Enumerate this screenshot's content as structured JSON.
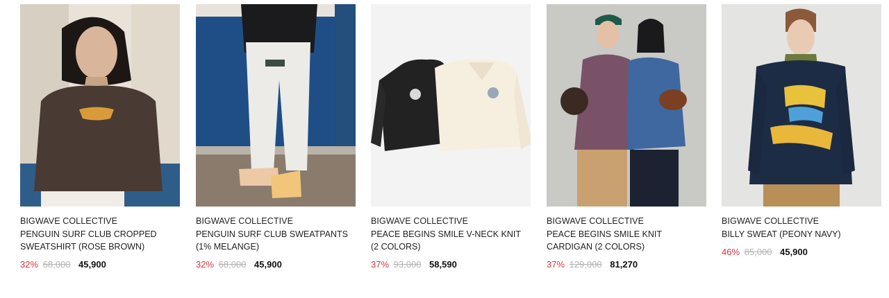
{
  "products": [
    {
      "brand": "BIGWAVE COLLECTIVE",
      "name": "PENGUIN SURF CLUB CROPPED SWEATSHIRT (ROSE BROWN)",
      "discount": "32%",
      "original_price": "68,000",
      "sale_price": "45,900"
    },
    {
      "brand": "BIGWAVE COLLECTIVE",
      "name": "PENGUIN SURF CLUB SWEATPANTS (1% MELANGE)",
      "discount": "32%",
      "original_price": "68,000",
      "sale_price": "45,900"
    },
    {
      "brand": "BIGWAVE COLLECTIVE",
      "name": "PEACE BEGINS SMILE V-NECK KNIT (2 COLORS)",
      "discount": "37%",
      "original_price": "93,000",
      "sale_price": "58,590"
    },
    {
      "brand": "BIGWAVE COLLECTIVE",
      "name": "PEACE BEGINS SMILE KNIT CARDIGAN (2 COLORS)",
      "discount": "37%",
      "original_price": "129,000",
      "sale_price": "81,270"
    },
    {
      "brand": "BIGWAVE COLLECTIVE",
      "name": "BILLY SWEAT (PEONY NAVY)",
      "discount": "46%",
      "original_price": "85,000",
      "sale_price": "45,900"
    }
  ],
  "colors": {
    "discount": "#e0333f",
    "original_price": "#b3b3b3",
    "sale_price": "#111111"
  }
}
